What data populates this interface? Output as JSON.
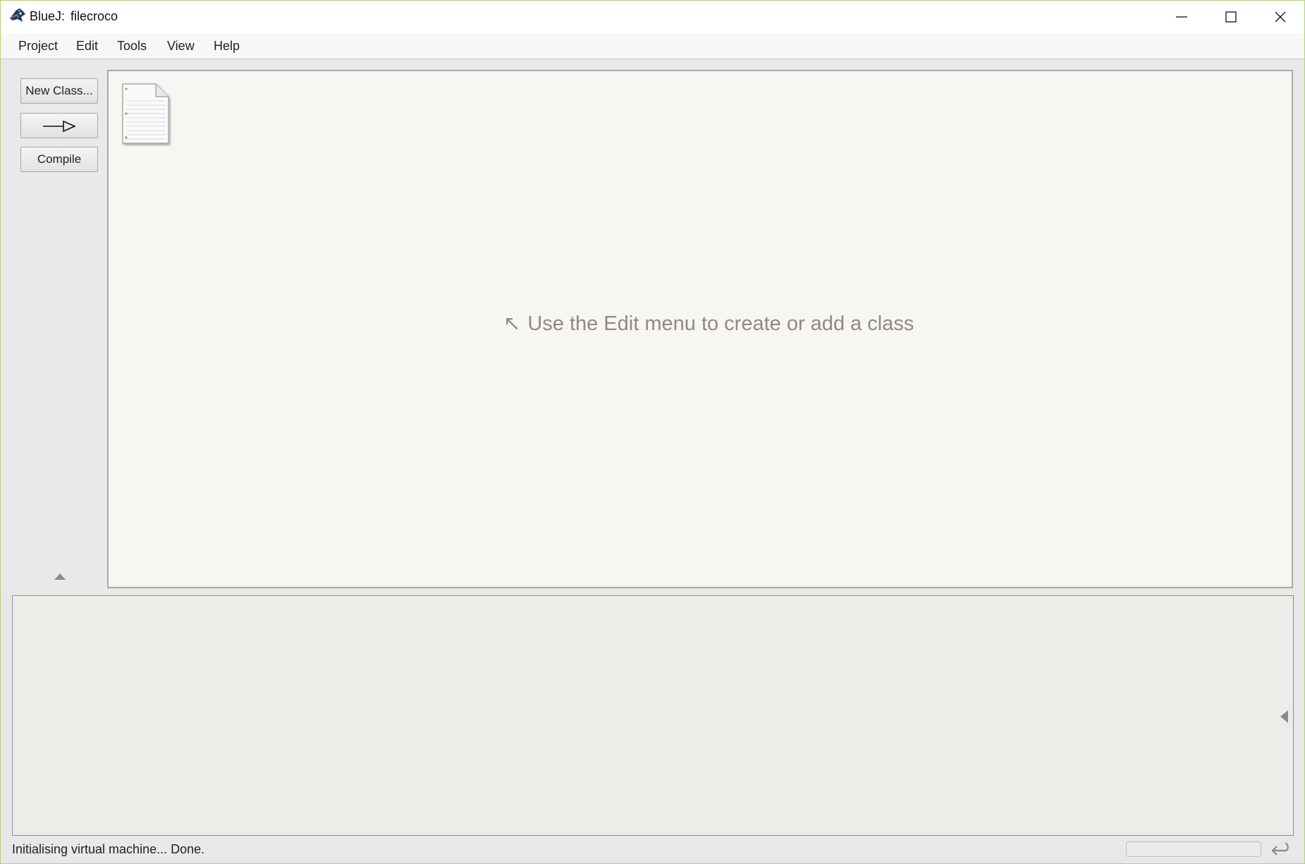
{
  "window": {
    "app_name": "BlueJ:",
    "project_name": "filecroco",
    "frame_color": "#b4cf7a"
  },
  "menu": {
    "items": [
      {
        "label": "Project"
      },
      {
        "label": "Edit"
      },
      {
        "label": "Tools"
      },
      {
        "label": "View"
      },
      {
        "label": "Help"
      }
    ]
  },
  "toolbar": {
    "new_class_label": "New Class...",
    "compile_label": "Compile",
    "arrow_icon": "inheritance-arrow-icon"
  },
  "canvas": {
    "hint_arrow": "↖",
    "hint_text": "Use the Edit menu to create or add a class",
    "readme_icon": "readme-document-icon"
  },
  "status": {
    "message": "Initialising virtual machine... Done."
  }
}
